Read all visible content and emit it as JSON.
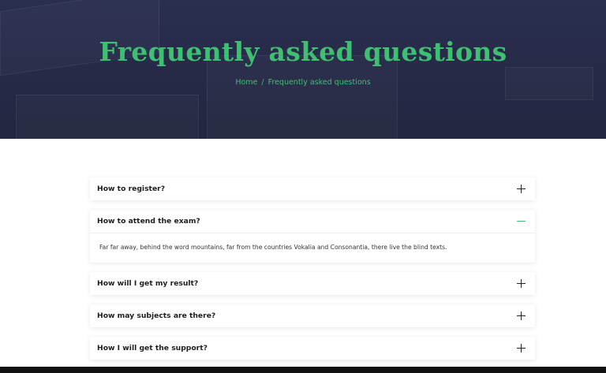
{
  "hero": {
    "title": "Frequently asked questions",
    "breadcrumb": {
      "home": "Home",
      "separator": "/",
      "current": "Frequently asked questions"
    }
  },
  "faq": {
    "items": [
      {
        "question": "How to register?",
        "expanded": false,
        "icon": "plus-icon"
      },
      {
        "question": "How to attend the exam?",
        "expanded": true,
        "icon": "minus-icon",
        "answer": "Far far away, behind the word mountains, far from the countries Vokalia and Consonantia, there live the blind texts."
      },
      {
        "question": "How will I get my result?",
        "expanded": false,
        "icon": "plus-icon"
      },
      {
        "question": "How may subjects are there?",
        "expanded": false,
        "icon": "plus-icon"
      },
      {
        "question": "How I will get the support?",
        "expanded": false,
        "icon": "plus-icon"
      }
    ]
  },
  "colors": {
    "accent": "#3fbf72",
    "hero_bg": "#262a47",
    "footer_bar": "#111111"
  }
}
